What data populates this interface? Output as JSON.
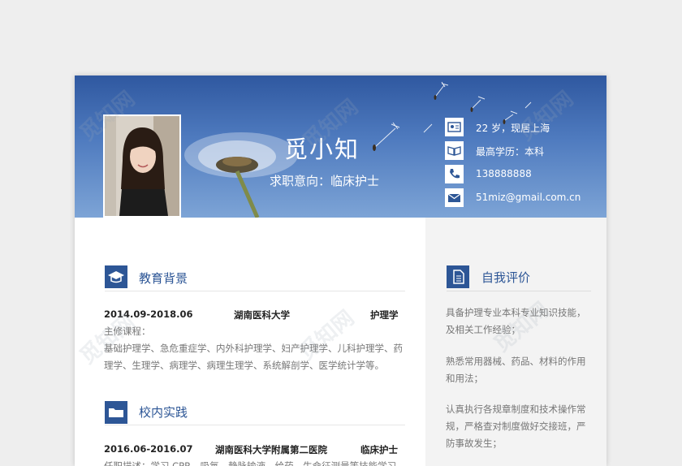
{
  "header": {
    "name": "觅小知",
    "job_intent": "求职意向：临床护士",
    "contacts": [
      {
        "icon": "id-card-icon",
        "text": "22 岁，现居上海"
      },
      {
        "icon": "book-icon",
        "text": "最高学历：本科"
      },
      {
        "icon": "phone-icon",
        "text": "138888888"
      },
      {
        "icon": "mail-icon",
        "text": "51miz@gmail.com.cn"
      }
    ]
  },
  "education": {
    "title": "教育背景",
    "period": "2014.09-2018.06",
    "school": "湖南医科大学",
    "major": "护理学",
    "courses_label": "主修课程：",
    "courses": "基础护理学、急危重症学、内外科护理学、妇产护理学、儿科护理学、药理学、生理学、病理学、病理生理学、系统解剖学、医学统计学等。"
  },
  "practice": {
    "title": "校内实践",
    "period": "2016.06-2016.07",
    "org": "湖南医科大学附属第二医院",
    "role": "临床护士",
    "desc": "任职描述：学习 CPR、吸氧、静脉输液、给药、生命征测量等技能学习"
  },
  "self_eval": {
    "title": "自我评价",
    "items": [
      "具备护理专业本科专业知识技能，及相关工作经验；",
      "熟悉常用器械、药品、材料的作用和用法；",
      "认真执行各规章制度和技术操作常规，严格查对制度做好交接班，严防事故发生；"
    ]
  },
  "watermark_text": "觅知网",
  "colors": {
    "primary": "#2d5696",
    "header_sky": "#4f7bbf",
    "right_column_bg": "#f3f3f3",
    "body_text": "#777777"
  }
}
